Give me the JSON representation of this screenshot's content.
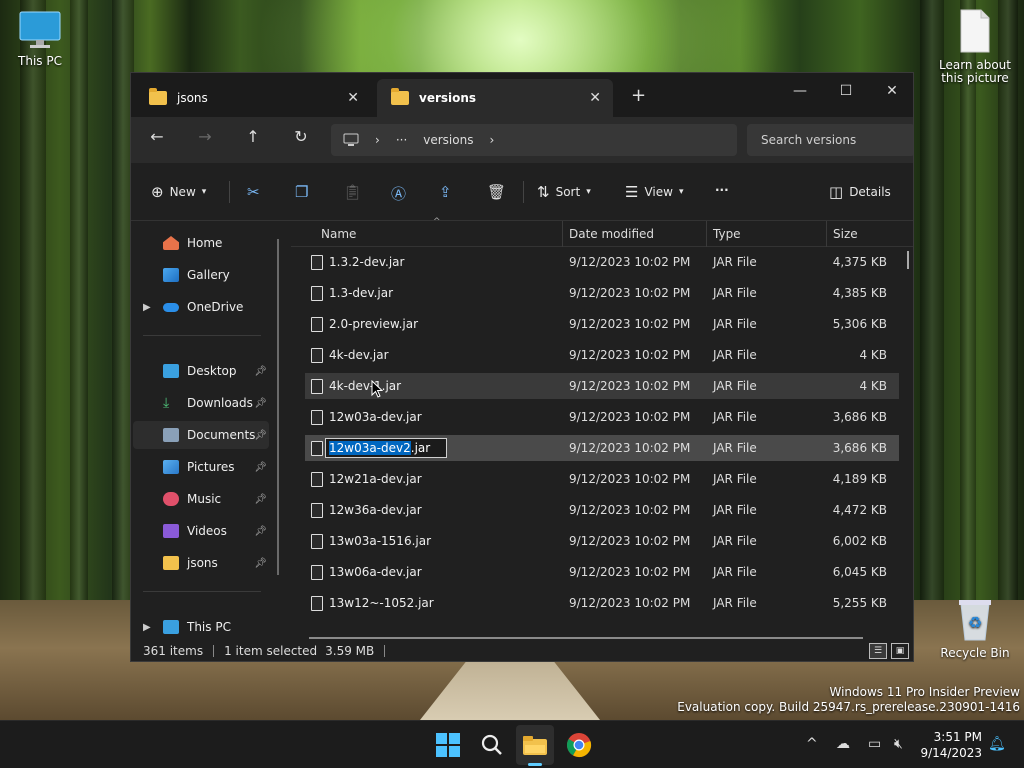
{
  "desktop": {
    "icons": [
      {
        "label": "This PC"
      },
      {
        "label": "Learn about this picture"
      },
      {
        "label": "Recycle Bin"
      }
    ],
    "watermark": {
      "line1": "Windows 11 Pro Insider Preview",
      "line2": "Evaluation copy. Build 25947.rs_prerelease.230901-1416"
    }
  },
  "window": {
    "tabs": [
      {
        "label": "jsons",
        "icon": "folder-icon"
      },
      {
        "label": "versions",
        "icon": "folder-icon",
        "active": true
      }
    ],
    "new_tab": "+",
    "controls": {
      "minimize": "—",
      "maximize": "☐",
      "close": "✕"
    },
    "nav": {
      "back": "←",
      "forward": "→",
      "up": "↑",
      "refresh": "↻",
      "address": {
        "monitor_icon": "pc-icon",
        "sep1": "›",
        "ellipsis": "···",
        "current": "versions",
        "sep2": "›"
      },
      "search_placeholder": "Search versions"
    },
    "commands": {
      "new": "New",
      "sort": "Sort",
      "view": "View",
      "more": "···",
      "details": "Details"
    },
    "sidebar": {
      "items": [
        {
          "label": "Home",
          "icon": "home-icon"
        },
        {
          "label": "Gallery",
          "icon": "gallery-icon"
        },
        {
          "label": "OneDrive",
          "icon": "cloud-icon"
        },
        {
          "label": "Desktop",
          "icon": "desktop-icon"
        },
        {
          "label": "Downloads",
          "icon": "download-icon"
        },
        {
          "label": "Documents",
          "icon": "documents-icon"
        },
        {
          "label": "Pictures",
          "icon": "pictures-icon"
        },
        {
          "label": "Music",
          "icon": "music-icon"
        },
        {
          "label": "Videos",
          "icon": "videos-icon"
        },
        {
          "label": "jsons",
          "icon": "folder-icon"
        },
        {
          "label": "This PC",
          "icon": "pc-icon"
        }
      ]
    },
    "columns": {
      "name": "Name",
      "date": "Date modified",
      "type": "Type",
      "size": "Size"
    },
    "files": [
      {
        "name": "1.3.2-dev.jar",
        "date": "9/12/2023 10:02 PM",
        "type": "JAR File",
        "size": "4,375 KB"
      },
      {
        "name": "1.3-dev.jar",
        "date": "9/12/2023 10:02 PM",
        "type": "JAR File",
        "size": "4,385 KB"
      },
      {
        "name": "2.0-preview.jar",
        "date": "9/12/2023 10:02 PM",
        "type": "JAR File",
        "size": "5,306 KB"
      },
      {
        "name": "4k-dev.jar",
        "date": "9/12/2023 10:02 PM",
        "type": "JAR File",
        "size": "4 KB"
      },
      {
        "name": "4k-dev-1.jar",
        "date": "9/12/2023 10:02 PM",
        "type": "JAR File",
        "size": "4 KB"
      },
      {
        "name": "12w03a-dev.jar",
        "date": "9/12/2023 10:02 PM",
        "type": "JAR File",
        "size": "3,686 KB"
      },
      {
        "name": "12w03a-dev2.jar",
        "rename_selected": "12w03a-dev2",
        "rename_ext": ".jar",
        "date": "9/12/2023 10:02 PM",
        "type": "JAR File",
        "size": "3,686 KB"
      },
      {
        "name": "12w21a-dev.jar",
        "date": "9/12/2023 10:02 PM",
        "type": "JAR File",
        "size": "4,189 KB"
      },
      {
        "name": "12w36a-dev.jar",
        "date": "9/12/2023 10:02 PM",
        "type": "JAR File",
        "size": "4,472 KB"
      },
      {
        "name": "13w03a-1516.jar",
        "date": "9/12/2023 10:02 PM",
        "type": "JAR File",
        "size": "6,002 KB"
      },
      {
        "name": "13w06a-dev.jar",
        "date": "9/12/2023 10:02 PM",
        "type": "JAR File",
        "size": "6,045 KB"
      },
      {
        "name": "13w12~-1052.jar",
        "date": "9/12/2023 10:02 PM",
        "type": "JAR File",
        "size": "5,255 KB"
      }
    ],
    "status": {
      "count": "361 items",
      "selection": "1 item selected",
      "size": "3.59 MB"
    }
  },
  "taskbar": {
    "clock_time": "3:51 PM",
    "clock_date": "9/14/2023",
    "tray_chevron": "^"
  },
  "colors": {
    "accent": "#0067c0",
    "tb_indicator": "#60cdff",
    "folder": "#f2c14c"
  }
}
